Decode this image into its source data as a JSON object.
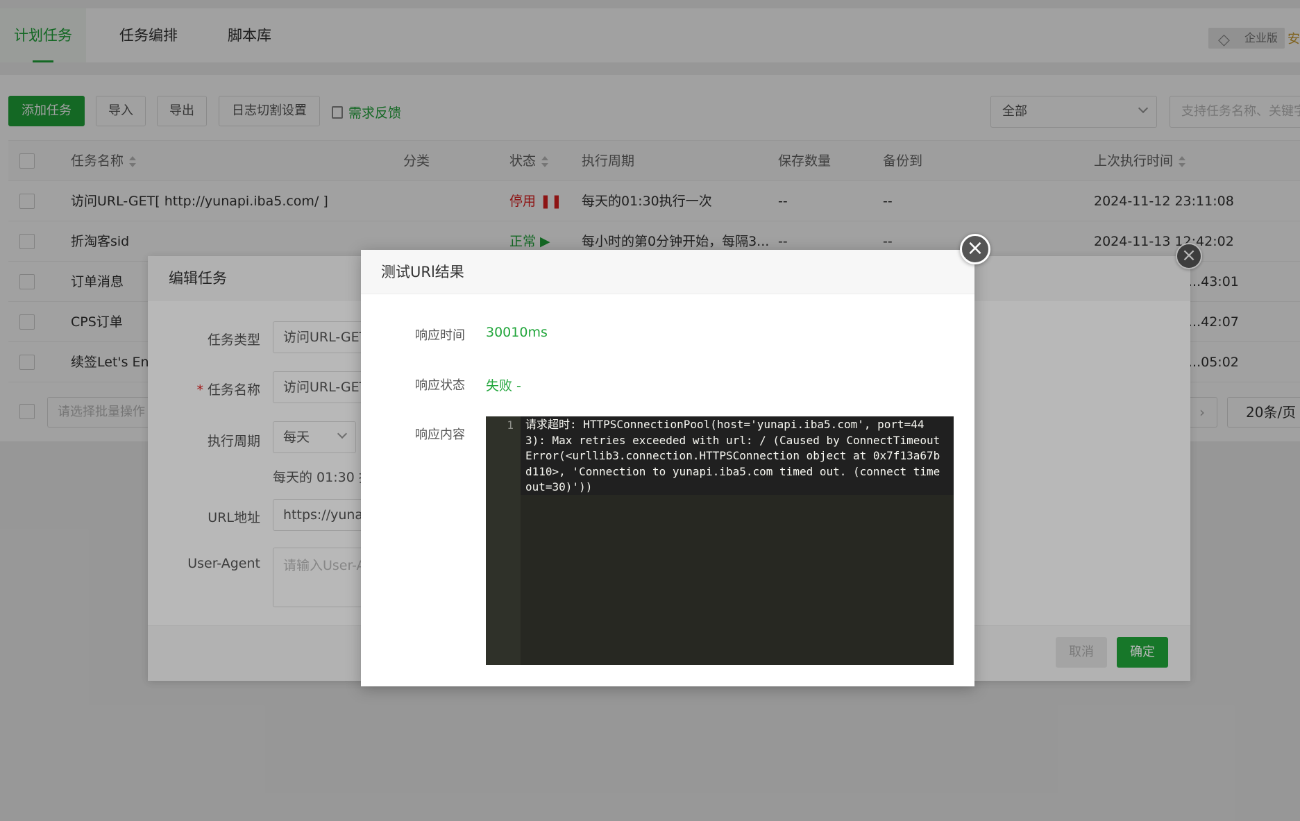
{
  "tabs": [
    "计划任务",
    "任务编排",
    "脚本库"
  ],
  "enterprise": {
    "label": "企业版",
    "extra": "安"
  },
  "toolbar": {
    "add": "添加任务",
    "import": "导入",
    "export": "导出",
    "log_split": "日志切割设置",
    "feedback": "需求反馈",
    "filter_value": "全部",
    "search_placeholder": "支持任务名称、关键字"
  },
  "table": {
    "headers": [
      "任务名称",
      "分类",
      "状态",
      "执行周期",
      "保存数量",
      "备份到",
      "上次执行时间"
    ],
    "rows": [
      {
        "name": "访问URL-GET[ http://yunapi.iba5.com/ ]",
        "status": "停用 ❚❚",
        "status_type": "stop",
        "cycle": "每天的01:30执行一次",
        "keep": "--",
        "backup": "--",
        "last": "2024-11-12 23:11:08"
      },
      {
        "name": "折淘客sid",
        "status": "正常 ▶",
        "status_type": "ok",
        "cycle": "每小时的第0分钟开始，每隔3...",
        "keep": "--",
        "backup": "--",
        "last": "2024-11-13 12:42:02"
      },
      {
        "name": "订单消息",
        "last": "...43:01"
      },
      {
        "name": "CPS订单",
        "last": "...42:07"
      },
      {
        "name": "续签Let's Enc",
        "last": "...05:02"
      }
    ],
    "batch_placeholder": "请选择批量操作",
    "page_size": "20条/页"
  },
  "edit_dialog": {
    "title": "编辑任务",
    "type_label": "任务类型",
    "type_value": "访问URL-GET",
    "name_label": "任务名称",
    "name_value": "访问URL-GET",
    "cycle_label": "执行周期",
    "cycle_value": "每天",
    "cycle_note": "每天的 01:30 执",
    "url_label": "URL地址",
    "url_value": "https://yunap",
    "ua_label": "User-Agent",
    "ua_placeholder": "请输入User-A",
    "cancel": "取消",
    "ok": "确定"
  },
  "result_dialog": {
    "title": "测试URl结果",
    "time_label": "响应时间",
    "time_value": "30010ms",
    "status_label": "响应状态",
    "status_value": "失败 -",
    "content_label": "响应内容",
    "line_number": "1",
    "content": "请求超时: HTTPSConnectionPool(host='yunapi.iba5.com', port=443): Max retries exceeded with url: / (Caused by ConnectTimeoutError(<urllib3.connection.HTTPSConnection object at 0x7f13a67bd110>, 'Connection to yunapi.iba5.com timed out. (connect timeout=30)'))"
  }
}
